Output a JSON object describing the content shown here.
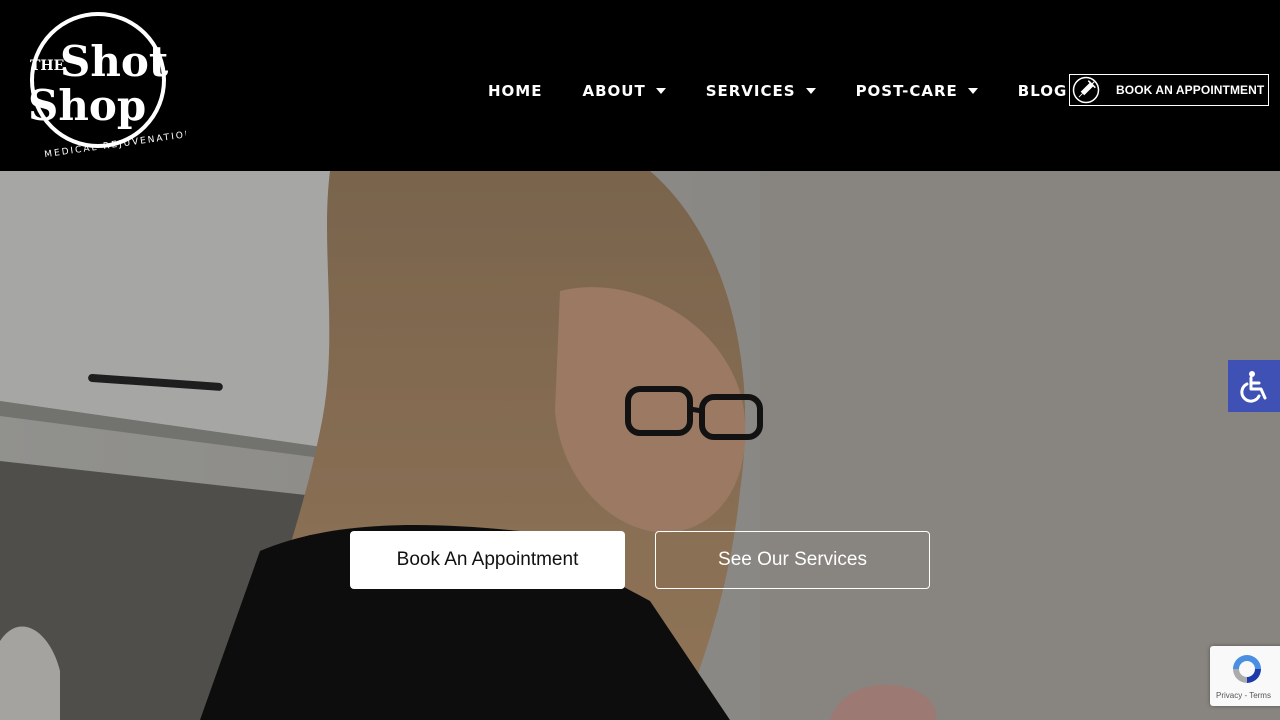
{
  "brand": {
    "logo_line1": "THE",
    "logo_line2": "Shot",
    "logo_line3": "Shop",
    "logo_tagline": "MEDICAL REJUVENATION"
  },
  "nav": {
    "items": [
      {
        "label": "HOME",
        "has_dropdown": false
      },
      {
        "label": "ABOUT",
        "has_dropdown": true
      },
      {
        "label": "SERVICES",
        "has_dropdown": true
      },
      {
        "label": "POST-CARE",
        "has_dropdown": true
      },
      {
        "label": "BLOG",
        "has_dropdown": false
      }
    ],
    "book_button": {
      "label": "BOOK AN APPOINTMENT",
      "icon": "syringe-icon"
    }
  },
  "hero": {
    "primary_cta": "Book An Appointment",
    "secondary_cta": "See Our Services"
  },
  "widgets": {
    "accessibility_icon": "wheelchair-icon",
    "accessibility_color": "#3f51b5",
    "recaptcha_text": "Privacy - Terms"
  },
  "colors": {
    "header_bg": "#000000",
    "button_bg": "#ffffff"
  }
}
